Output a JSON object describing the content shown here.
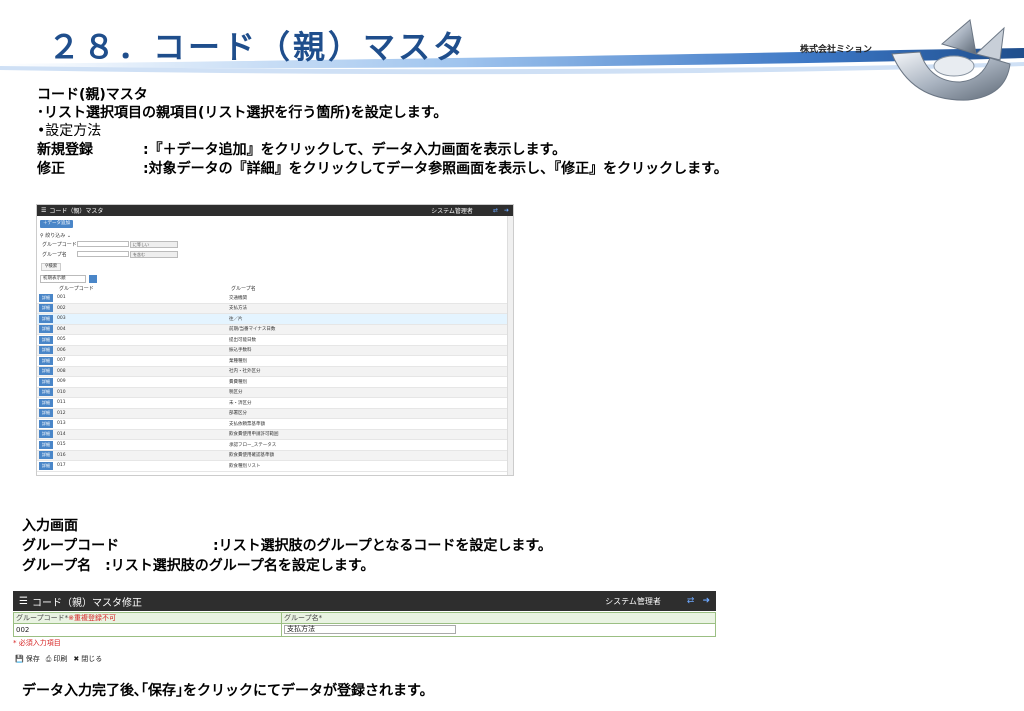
{
  "header": {
    "title": "２８．コード（親）マスタ",
    "company": "株式会社ミション",
    "brand_color": "#1f4e8c"
  },
  "intro": {
    "heading": "コード(親)マスタ",
    "line1": "･リスト選択項目の親項目(リスト選択を行う箇所)を設定します。",
    "line2": "•設定方法",
    "row1_term": "新規登録",
    "row1_desc": ":『＋データ追加』をクリックして、データ入力画面を表示します。",
    "row2_term": "修正",
    "row2_desc": ":対象データの『詳細』をクリックしてデータ参照画面を表示し、『修正』をクリックします。"
  },
  "list_screen": {
    "title": "コード（親）マスタ",
    "user": "システム管理者",
    "add_button": "＋データ追加",
    "filter_toggle": "絞り込み",
    "filter_code_label": "グループコード",
    "filter_code_op": "に等しい",
    "filter_name_label": "グループ名",
    "filter_name_op": "を含む",
    "search_button": "検索",
    "sort_select": "初期表示順",
    "col_code": "グループコード",
    "col_name": "グループ名",
    "detail_label": "詳細",
    "rows": [
      {
        "code": "001",
        "name": "交通機関"
      },
      {
        "code": "002",
        "name": "支払方法"
      },
      {
        "code": "003",
        "name": "往／片"
      },
      {
        "code": "004",
        "name": "前期/当番マイナス日数"
      },
      {
        "code": "005",
        "name": "提出可能日数"
      },
      {
        "code": "006",
        "name": "振込手数料"
      },
      {
        "code": "007",
        "name": "業種種別"
      },
      {
        "code": "008",
        "name": "社内・社外区分"
      },
      {
        "code": "009",
        "name": "費費種別"
      },
      {
        "code": "010",
        "name": "税区分"
      },
      {
        "code": "011",
        "name": "未・済区分"
      },
      {
        "code": "012",
        "name": "部署区分"
      },
      {
        "code": "013",
        "name": "支払依頼票基準額"
      },
      {
        "code": "014",
        "name": "飲食費使用申請許可範囲"
      },
      {
        "code": "015",
        "name": "承認フロー_ステータス"
      },
      {
        "code": "016",
        "name": "飲食費使用確認基準額"
      },
      {
        "code": "017",
        "name": "飲食種別リスト"
      }
    ]
  },
  "input_section": {
    "heading": "入力画面",
    "row1_term": "グループコード",
    "row1_desc": ":リスト選択肢のグループとなるコードを設定します。",
    "row2": "グループ名　:リスト選択肢のグループ名を設定します。"
  },
  "edit_screen": {
    "title": "コード（親）マスタ修正",
    "user": "システム管理者",
    "code_label": "グループコード*",
    "code_note": "※重複登録不可",
    "name_label": "グループ名*",
    "code_value": "002",
    "name_value": "支払方法",
    "required_note": "* 必須入力項目",
    "save": "保存",
    "print": "印刷",
    "close": "閉じる"
  },
  "footer_text": "データ入力完了後､｢保存｣をクリックにてデータが登録されます。"
}
